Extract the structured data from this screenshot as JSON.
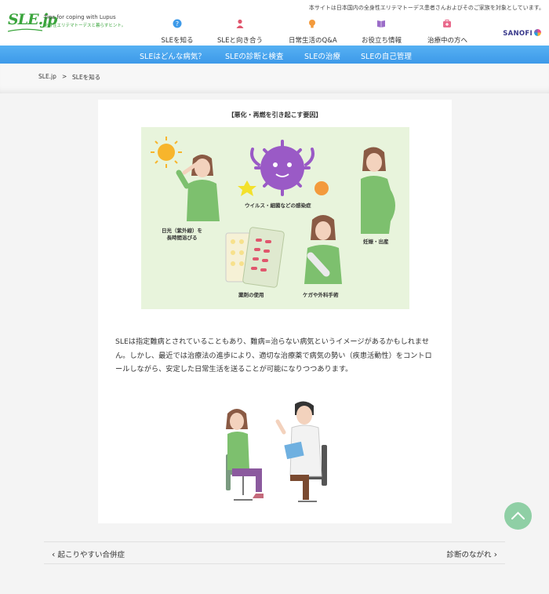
{
  "header": {
    "notice": "本サイトは日本国内の全身性エリテマトーデス患者さんおよびそのご家族を対象としています。",
    "logo_mark": "SLE.jp",
    "logo_tagline": "Tips for coping with Lupus",
    "logo_sub": "全身性エリテマトーデスと暮らすヒント。",
    "nav": [
      {
        "label": "SLEを知る",
        "icon": "question-icon",
        "color": "#3d9ae9"
      },
      {
        "label": "SLEと向き合う",
        "icon": "person-icon",
        "color": "#e0566d"
      },
      {
        "label": "日常生活のQ&A",
        "icon": "lightbulb-icon",
        "color": "#f39a3c"
      },
      {
        "label": "お役立ち情報",
        "icon": "book-icon",
        "color": "#9b6cc8"
      },
      {
        "label": "治療中の方へ",
        "icon": "medical-bag-icon",
        "color": "#e96a8c"
      }
    ],
    "sponsor": "SANOFI"
  },
  "subnav": [
    "SLEはどんな病気？",
    "SLEの診断と検査",
    "SLEの治療",
    "SLEの自己管理"
  ],
  "breadcrumb": {
    "home": "SLE.jp",
    "sep": ">",
    "current": "SLEを知る"
  },
  "figure": {
    "caption": "【悪化・再燃を引き起こす要因】",
    "labels": {
      "sun": "日光（紫外線）を\n長時間浴びる",
      "virus": "ウイルス・細菌などの感染症",
      "pregnancy": "妊娠・出産",
      "drugs": "薬剤の使用",
      "injury": "ケガや外科手術"
    }
  },
  "body_text": "SLEは指定難病とされていることもあり、難病=治らない病気というイメージがあるかもしれません。しかし、最近では治療法の進歩により、適切な治療薬で病気の勢い（疾患活動性）をコントロールしながら、安定した日常生活を送ることが可能になりつつあります。",
  "pager": {
    "prev": "起こりやすい合併症",
    "next": "診断のながれ"
  },
  "colors": {
    "brand_green": "#3aa53c",
    "nav_blue": "#3d9ae9",
    "to_top": "#8fcfa5"
  }
}
